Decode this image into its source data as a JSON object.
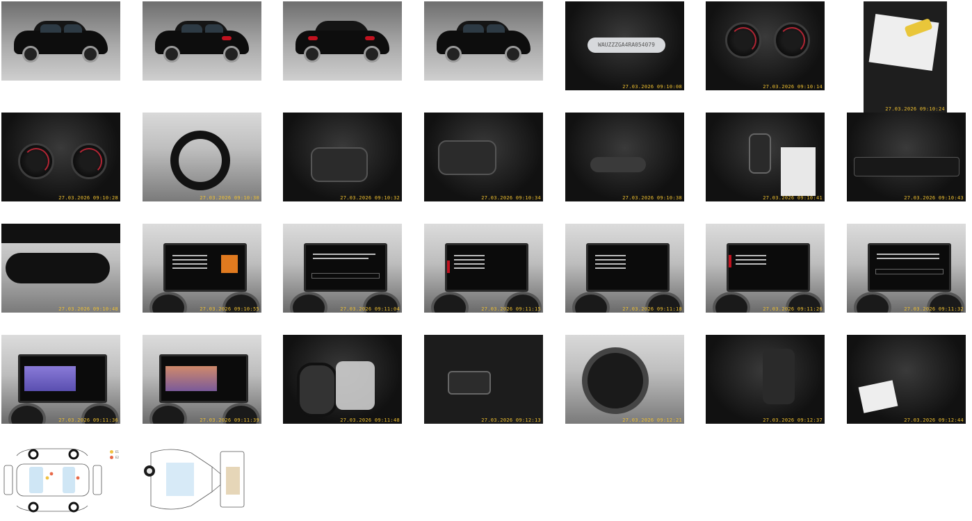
{
  "gallery": {
    "timestamps": {
      "t05": "27.03.2026 09:10:08",
      "t06": "27.03.2026 09:10:14",
      "t07": "27.03.2026 09:10:24",
      "t08": "27.03.2026 09:10:28",
      "t09": "27.03.2026 09:10:30",
      "t10": "27.03.2026 09:10:32",
      "t11": "27.03.2026 09:10:34",
      "t12": "27.03.2026 09:10:38",
      "t13": "27.03.2026 09:10:41",
      "t14": "27.03.2026 09:10:43",
      "t15": "27.03.2026 09:10:48",
      "t16": "27.03.2026 09:10:55",
      "t17": "27.03.2026 09:11:04",
      "t18": "27.03.2026 09:11:15",
      "t19": "27.03.2026 09:11:18",
      "t20": "27.03.2026 09:11:26",
      "t21": "27.03.2026 09:11:32",
      "t22": "27.03.2026 09:11:36",
      "t23": "27.03.2026 09:11:39",
      "t24": "27.03.2026 09:11:48",
      "t25": "27.03.2026 09:12:13",
      "t26": "27.03.2026 09:12:21",
      "t27": "27.03.2026 09:12:37",
      "t28": "27.03.2026 09:12:44"
    },
    "vin_plate_text": "WAUZZZGA4RA054079",
    "diagram_legend": {
      "item1": "E1",
      "item2": "E2",
      "color1": "#f0c040",
      "color2": "#e86a4a"
    },
    "icons": [
      "car-photo-icon",
      "dashboard-icon",
      "infotainment-screen-icon",
      "damage-diagram-icon"
    ]
  }
}
